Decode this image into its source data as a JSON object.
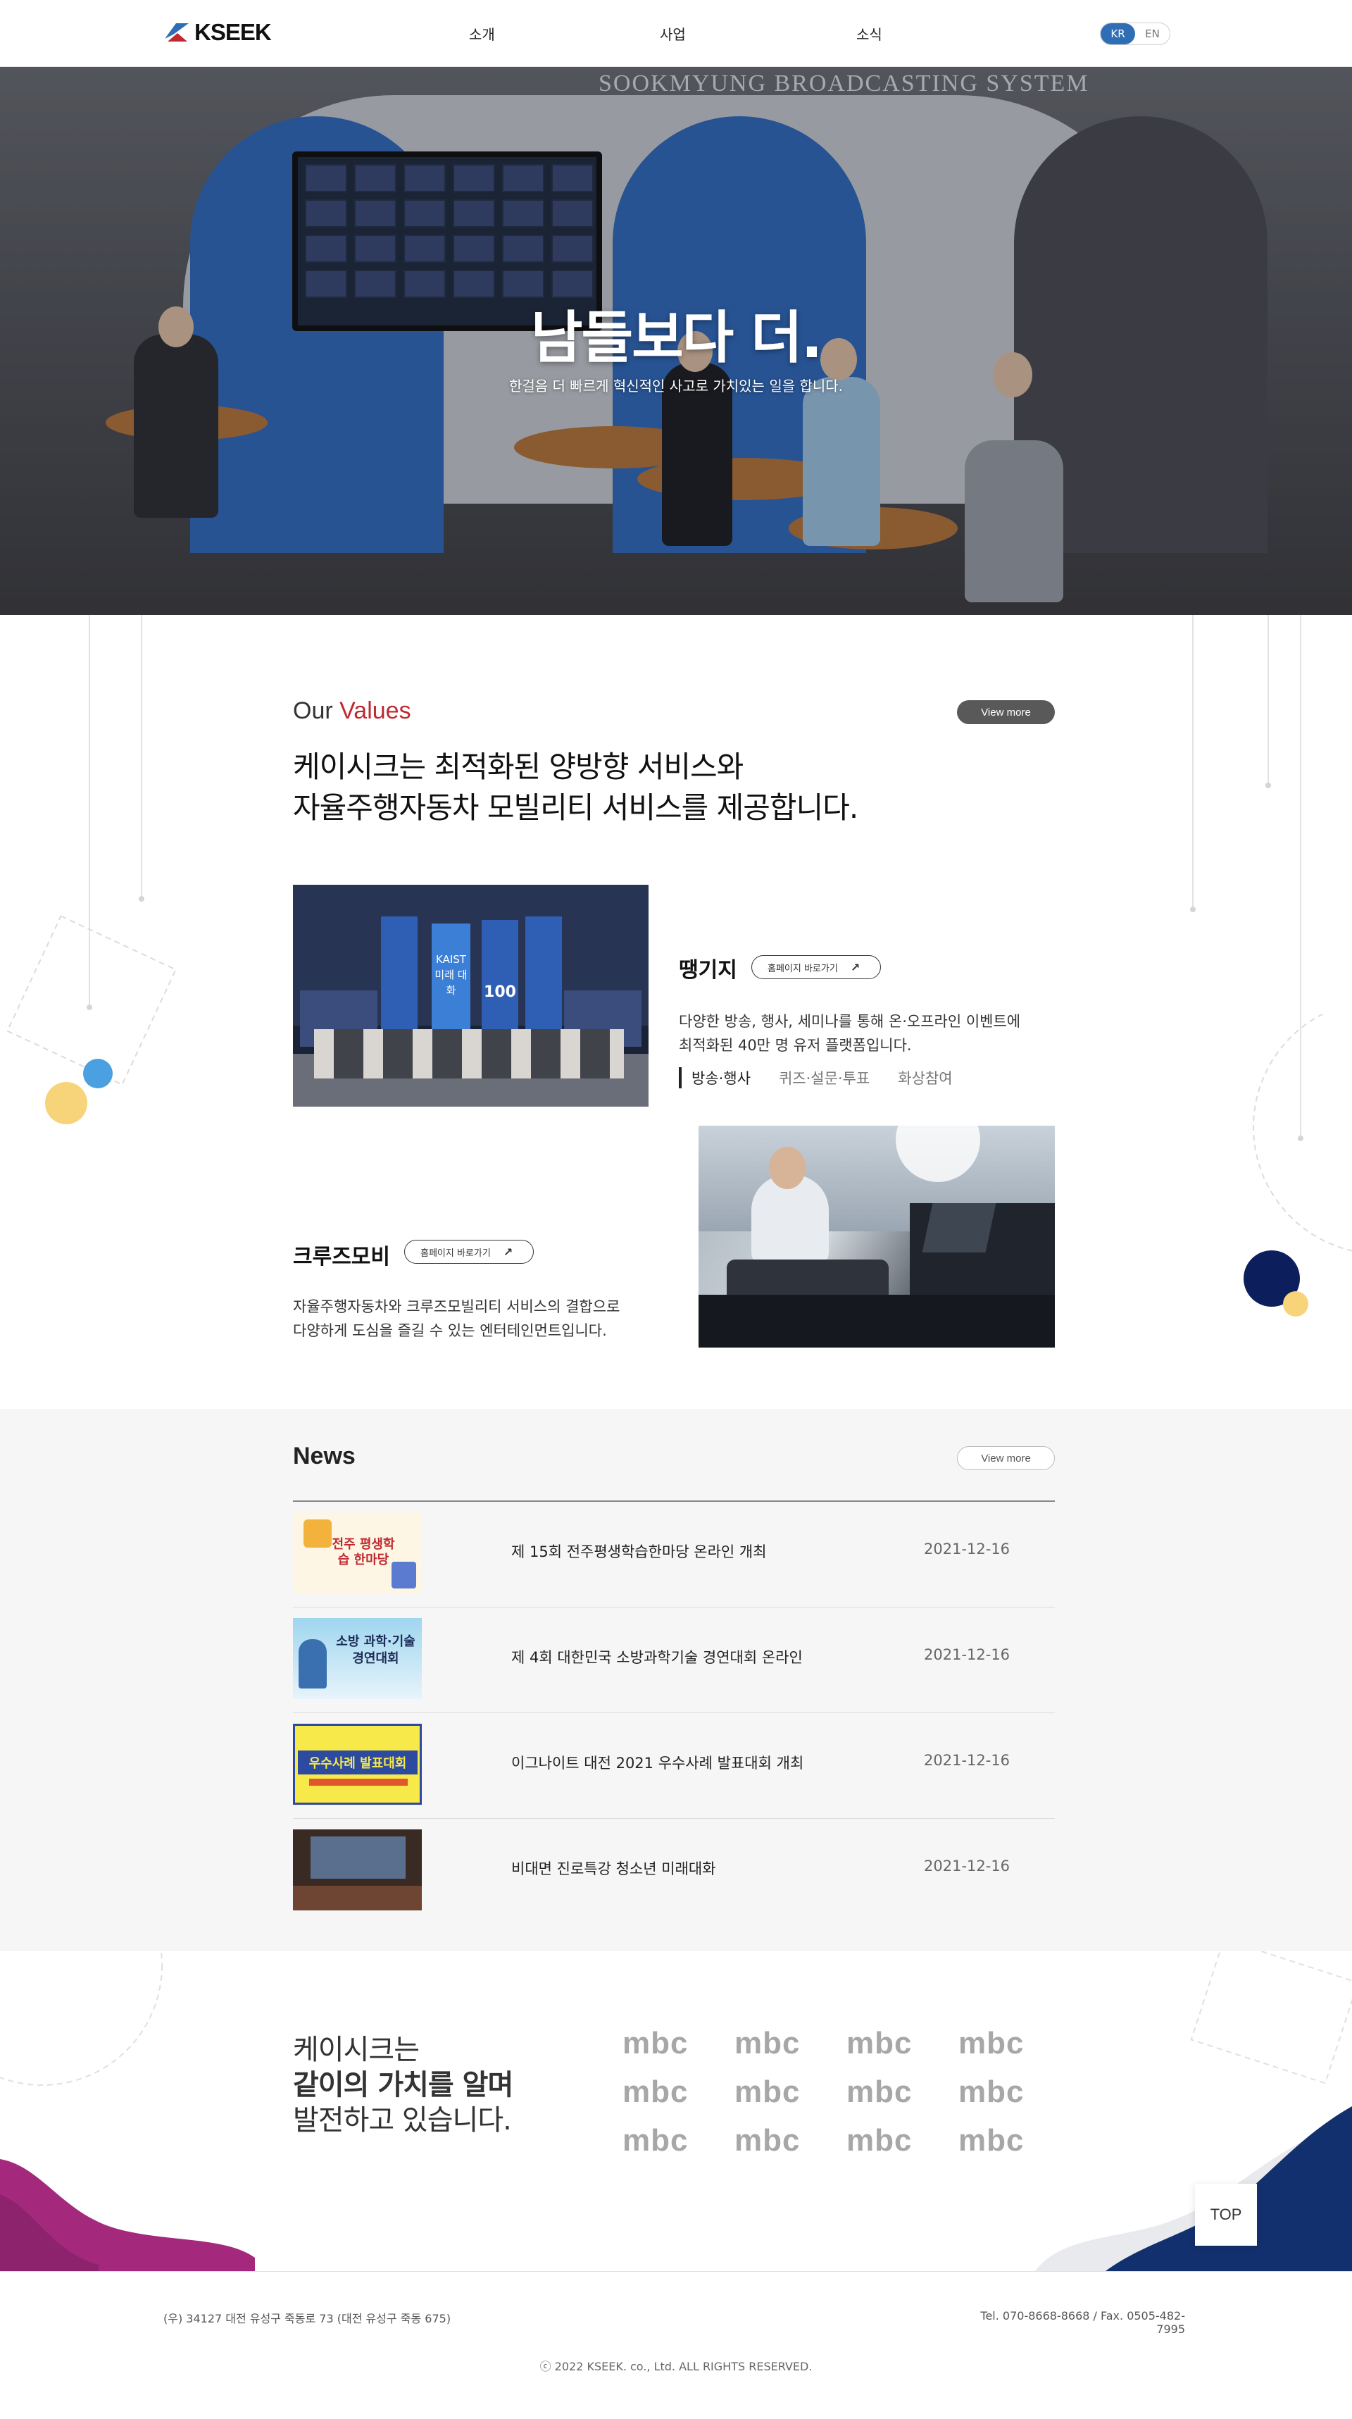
{
  "header": {
    "logo_text": "KSEEK",
    "nav": [
      "소개",
      "사업",
      "소식"
    ],
    "lang": {
      "kr": "KR",
      "en": "EN",
      "active": "KR"
    }
  },
  "hero": {
    "sign_text": "SOOKMYUNG BROADCASTING SYSTEM",
    "title": "남들보다 더.",
    "subtitle": "한걸음 더 빠르게 혁신적인 사고로 가치있는 일을 합니다."
  },
  "values": {
    "heading_prefix": "Our",
    "heading_accent": "Values",
    "view_more": "View more",
    "lede_line1": "케이시크는 최적화된 양방향 서비스와",
    "lede_line2": "자율주행자동차 모빌리티 서비스를 제공합니다.",
    "services": [
      {
        "title": "땡기지",
        "link": "홈페이지 바로가기",
        "desc_line1": "다양한 방송, 행사, 세미나를 통해 온·오프라인 이벤트에",
        "desc_line2": "최적화된 40만 명 유저 플랫폼입니다.",
        "tags": [
          "방송·행사",
          "퀴즈·설문·투표",
          "화상참여"
        ]
      },
      {
        "title": "크루즈모비",
        "link": "홈페이지 바로가기",
        "desc_line1": "자율주행자동차와 크루즈모빌리티 서비스의 결합으로",
        "desc_line2": "다양하게 도심을 즐길 수 있는 엔터테인먼트입니다."
      }
    ],
    "photo1_banners": [
      "KAIST 미래 대화",
      "100"
    ]
  },
  "news": {
    "title": "News",
    "view_more": "View more",
    "items": [
      {
        "title": "제 15회 전주평생학습한마당 온라인 개최",
        "date": "2021-12-16",
        "thumb_text": "전주 평생학습 한마당"
      },
      {
        "title": "제 4회 대한민국 소방과학기술 경연대회 온라인",
        "date": "2021-12-16",
        "thumb_text": "소방 과학·기술 경연대회"
      },
      {
        "title": "이그나이트 대전 2021 우수사례 발표대회 개최",
        "date": "2021-12-16",
        "thumb_text": "우수사례 발표대회"
      },
      {
        "title": "비대면 진로특강 청소년 미래대화",
        "date": "2021-12-16",
        "thumb_text": ""
      }
    ]
  },
  "partners": {
    "line1": "케이시크는",
    "line2": "같이의 가치를 알며",
    "line3": "발전하고 있습니다.",
    "logos": [
      "MBC",
      "MBC",
      "MBC",
      "MBC",
      "MBC",
      "MBC",
      "MBC",
      "MBC",
      "MBC",
      "MBC",
      "MBC",
      "MBC"
    ]
  },
  "top_button": "TOP",
  "footer": {
    "address": "(우) 34127 대전 유성구 죽동로 73 (대전 유성구 죽동 675)",
    "tel": "Tel. 070-8668-8668 / Fax. 0505-482-7995",
    "copyright": "ⓒ 2022 KSEEK. co., Ltd.  ALL RIGHTS RESERVED."
  },
  "colors": {
    "accent_red": "#c0292f",
    "lang_active": "#2f6eb5",
    "navy_circle": "#0c1f5c",
    "yellow_circle": "#f7d37a",
    "blue_circle": "#4aa0e0",
    "magenta_wave": "#a4297d",
    "navy_wave": "#13306e"
  }
}
